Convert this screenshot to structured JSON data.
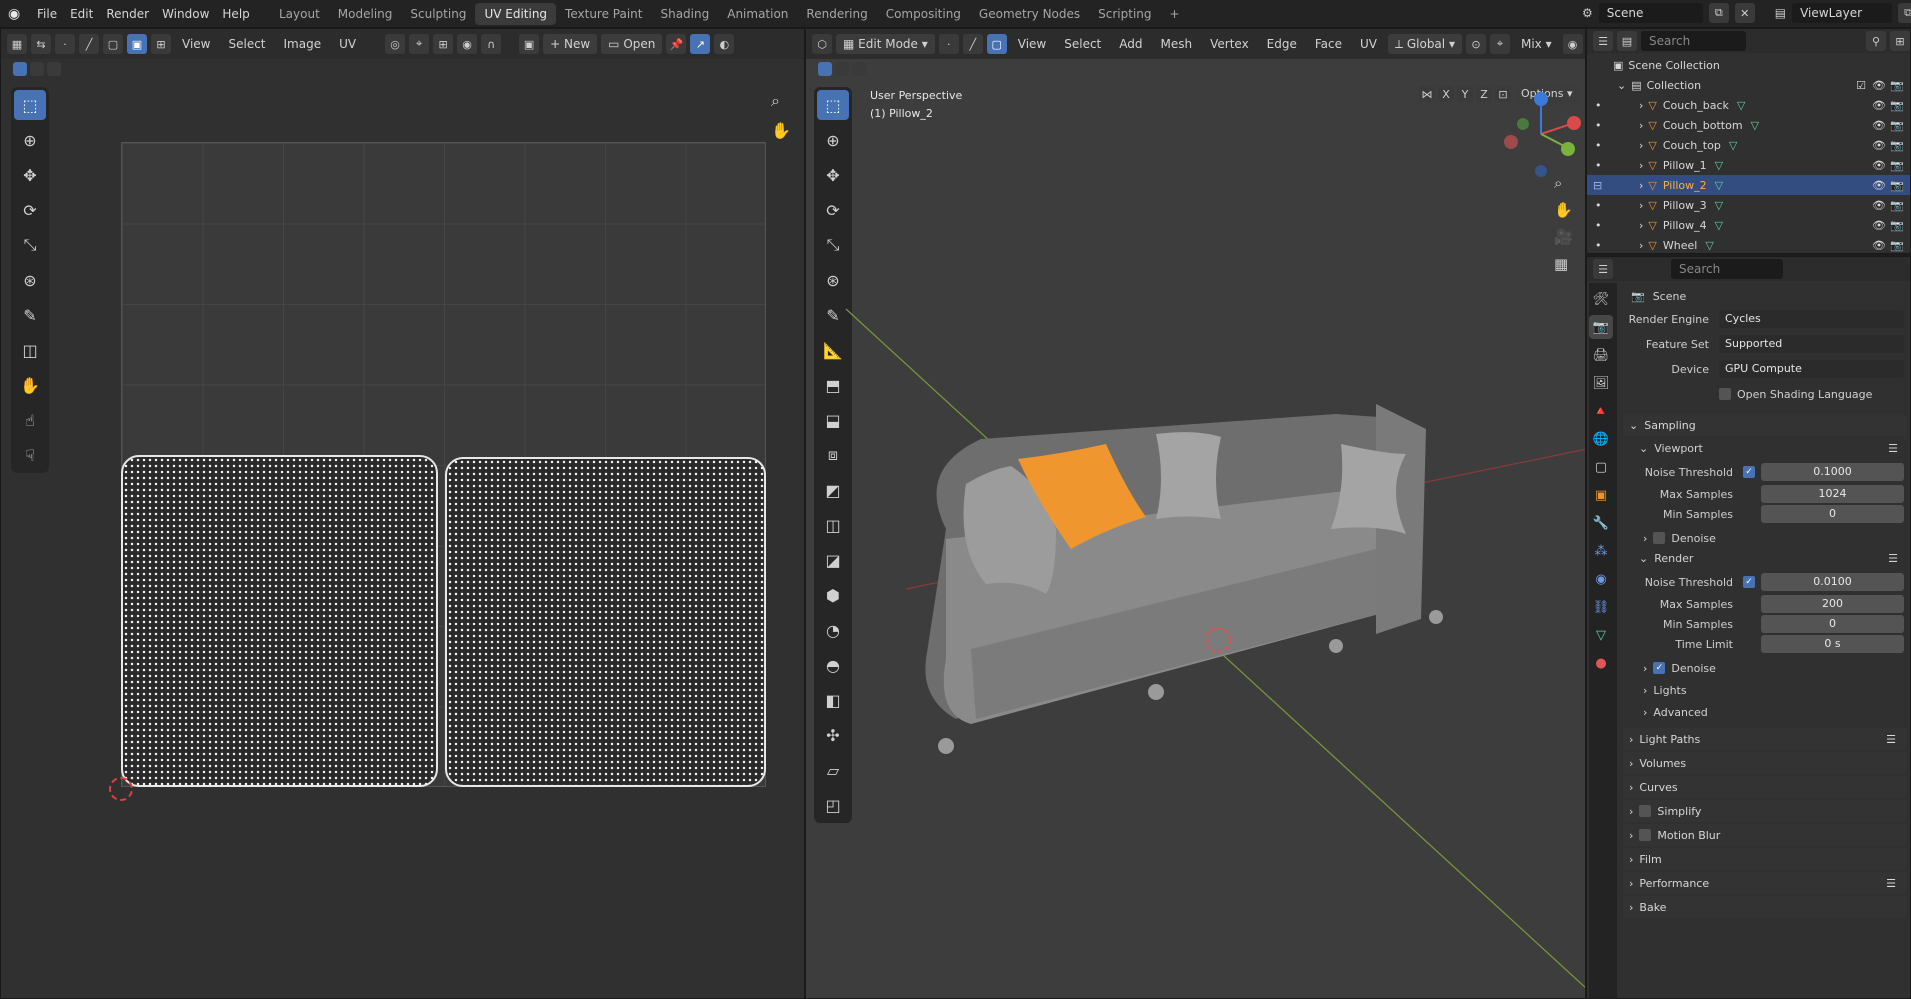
{
  "topbar": {
    "menu": [
      "File",
      "Edit",
      "Render",
      "Window",
      "Help"
    ],
    "workspaces": [
      "Layout",
      "Modeling",
      "Sculpting",
      "UV Editing",
      "Texture Paint",
      "Shading",
      "Animation",
      "Rendering",
      "Compositing",
      "Geometry Nodes",
      "Scripting"
    ],
    "active_workspace": "UV Editing",
    "scene": "Scene",
    "view_layer": "ViewLayer",
    "add_tab": "+"
  },
  "uv_editor": {
    "menu": [
      "View",
      "Select",
      "Image",
      "UV"
    ],
    "new_label": "New",
    "open_label": "Open"
  },
  "viewport": {
    "mode": "Edit Mode",
    "menu": [
      "View",
      "Select",
      "Add",
      "Mesh",
      "Vertex",
      "Edge",
      "Face",
      "UV"
    ],
    "transform": "Global",
    "shading": "Mix",
    "options_label": "Options",
    "overlay_line1": "User Perspective",
    "overlay_line2": "(1) Pillow_2",
    "axis_x": "X",
    "axis_y": "Y",
    "axis_z": "Z"
  },
  "outliner": {
    "search_placeholder": "Search",
    "root": "Scene Collection",
    "collection": "Collection",
    "items": [
      "Couch_back",
      "Couch_bottom",
      "Couch_top",
      "Pillow_1",
      "Pillow_2",
      "Pillow_3",
      "Pillow_4",
      "Wheel"
    ],
    "selected": "Pillow_2"
  },
  "properties": {
    "search_placeholder": "Search",
    "context": "Scene",
    "render_engine_label": "Render Engine",
    "render_engine": "Cycles",
    "feature_set_label": "Feature Set",
    "feature_set": "Supported",
    "device_label": "Device",
    "device": "GPU Compute",
    "osl_label": "Open Shading Language",
    "sampling": "Sampling",
    "viewport": "Viewport",
    "noise_threshold_label": "Noise Threshold",
    "vp_noise": "0.1000",
    "max_samples_label": "Max Samples",
    "vp_max": "1024",
    "min_samples_label": "Min Samples",
    "vp_min": "0",
    "denoise_label": "Denoise",
    "render": "Render",
    "r_noise": "0.0100",
    "r_max": "200",
    "r_min": "0",
    "time_limit_label": "Time Limit",
    "time_limit": "0 s",
    "lights": "Lights",
    "advanced": "Advanced",
    "panels": [
      "Light Paths",
      "Volumes",
      "Curves",
      "Simplify",
      "Motion Blur",
      "Film",
      "Performance",
      "Bake"
    ]
  }
}
